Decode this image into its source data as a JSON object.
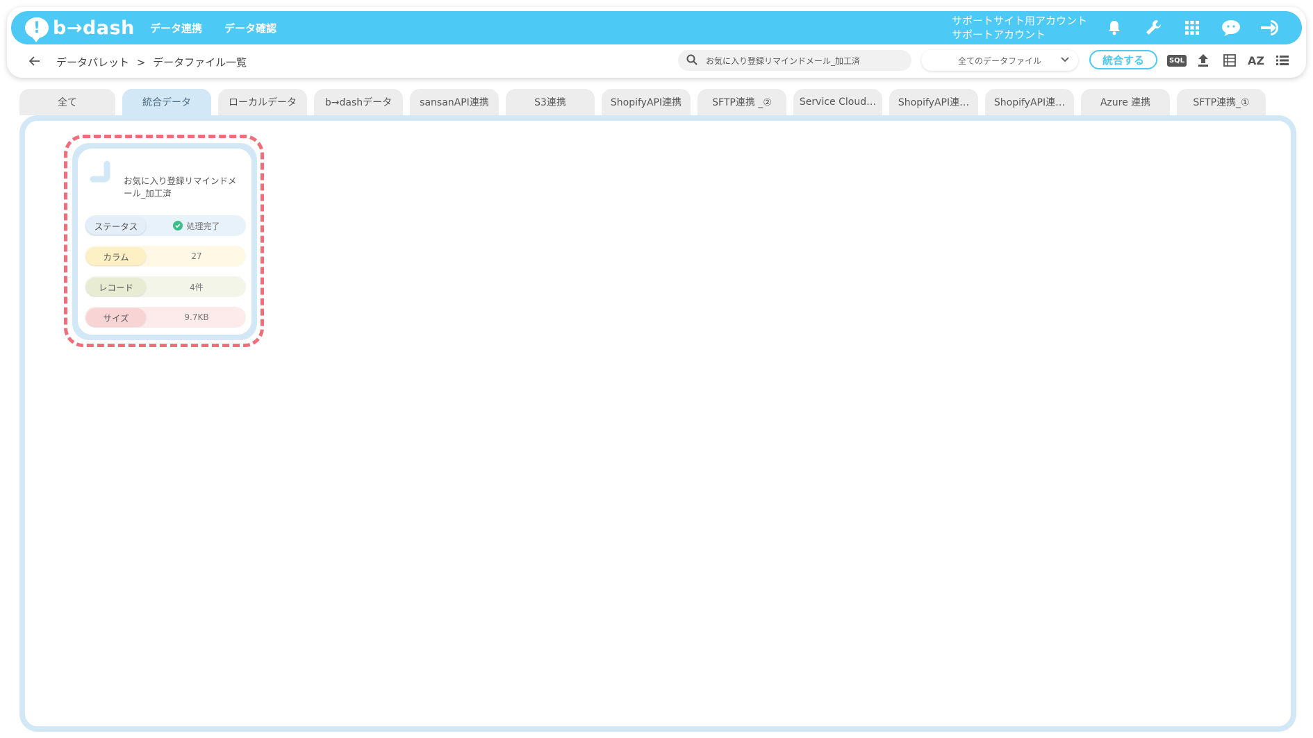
{
  "header": {
    "logo_text": "b→dash",
    "nav": [
      "データ連携",
      "データ確認"
    ],
    "account_line1": "サポートサイト用アカウント",
    "account_line2": "サポートアカウント"
  },
  "breadcrumb": {
    "parent": "データパレット",
    "separator": ">",
    "current": "データファイル一覧"
  },
  "search": {
    "value": "お気に入り登録リマインドメール_加工済"
  },
  "filter_select": {
    "selected": "全てのデータファイル"
  },
  "merge_button": {
    "label": "統合する"
  },
  "toolbar": {
    "sql_label": "SQL",
    "sort_label": "AZ"
  },
  "tabs": [
    {
      "label": "全て",
      "active": false
    },
    {
      "label": "統合データ",
      "active": true
    },
    {
      "label": "ローカルデータ",
      "active": false
    },
    {
      "label": "b→dashデータ",
      "active": false
    },
    {
      "label": "sansanAPI連携",
      "active": false
    },
    {
      "label": "S3連携",
      "active": false
    },
    {
      "label": "ShopifyAPI連携",
      "active": false
    },
    {
      "label": "SFTP連携 _②",
      "active": false
    },
    {
      "label": "Service Cloud…",
      "active": false
    },
    {
      "label": "ShopifyAPI連…",
      "active": false
    },
    {
      "label": "ShopifyAPI連…",
      "active": false
    },
    {
      "label": "Azure 連携",
      "active": false
    },
    {
      "label": "SFTP連携_①",
      "active": false
    }
  ],
  "card": {
    "title": "お気に入り登録リマインドメール_加工済",
    "status_label": "ステータス",
    "status_value": "処理完了",
    "column_label": "カラム",
    "column_value": "27",
    "record_label": "レコード",
    "record_value": "4件",
    "size_label": "サイズ",
    "size_value": "9.7KB"
  },
  "colors": {
    "brand": "#4cc9f5",
    "tab_active": "#d2e8f7",
    "highlight": "#ee6f7a",
    "status_ok": "#3bbf8a"
  }
}
